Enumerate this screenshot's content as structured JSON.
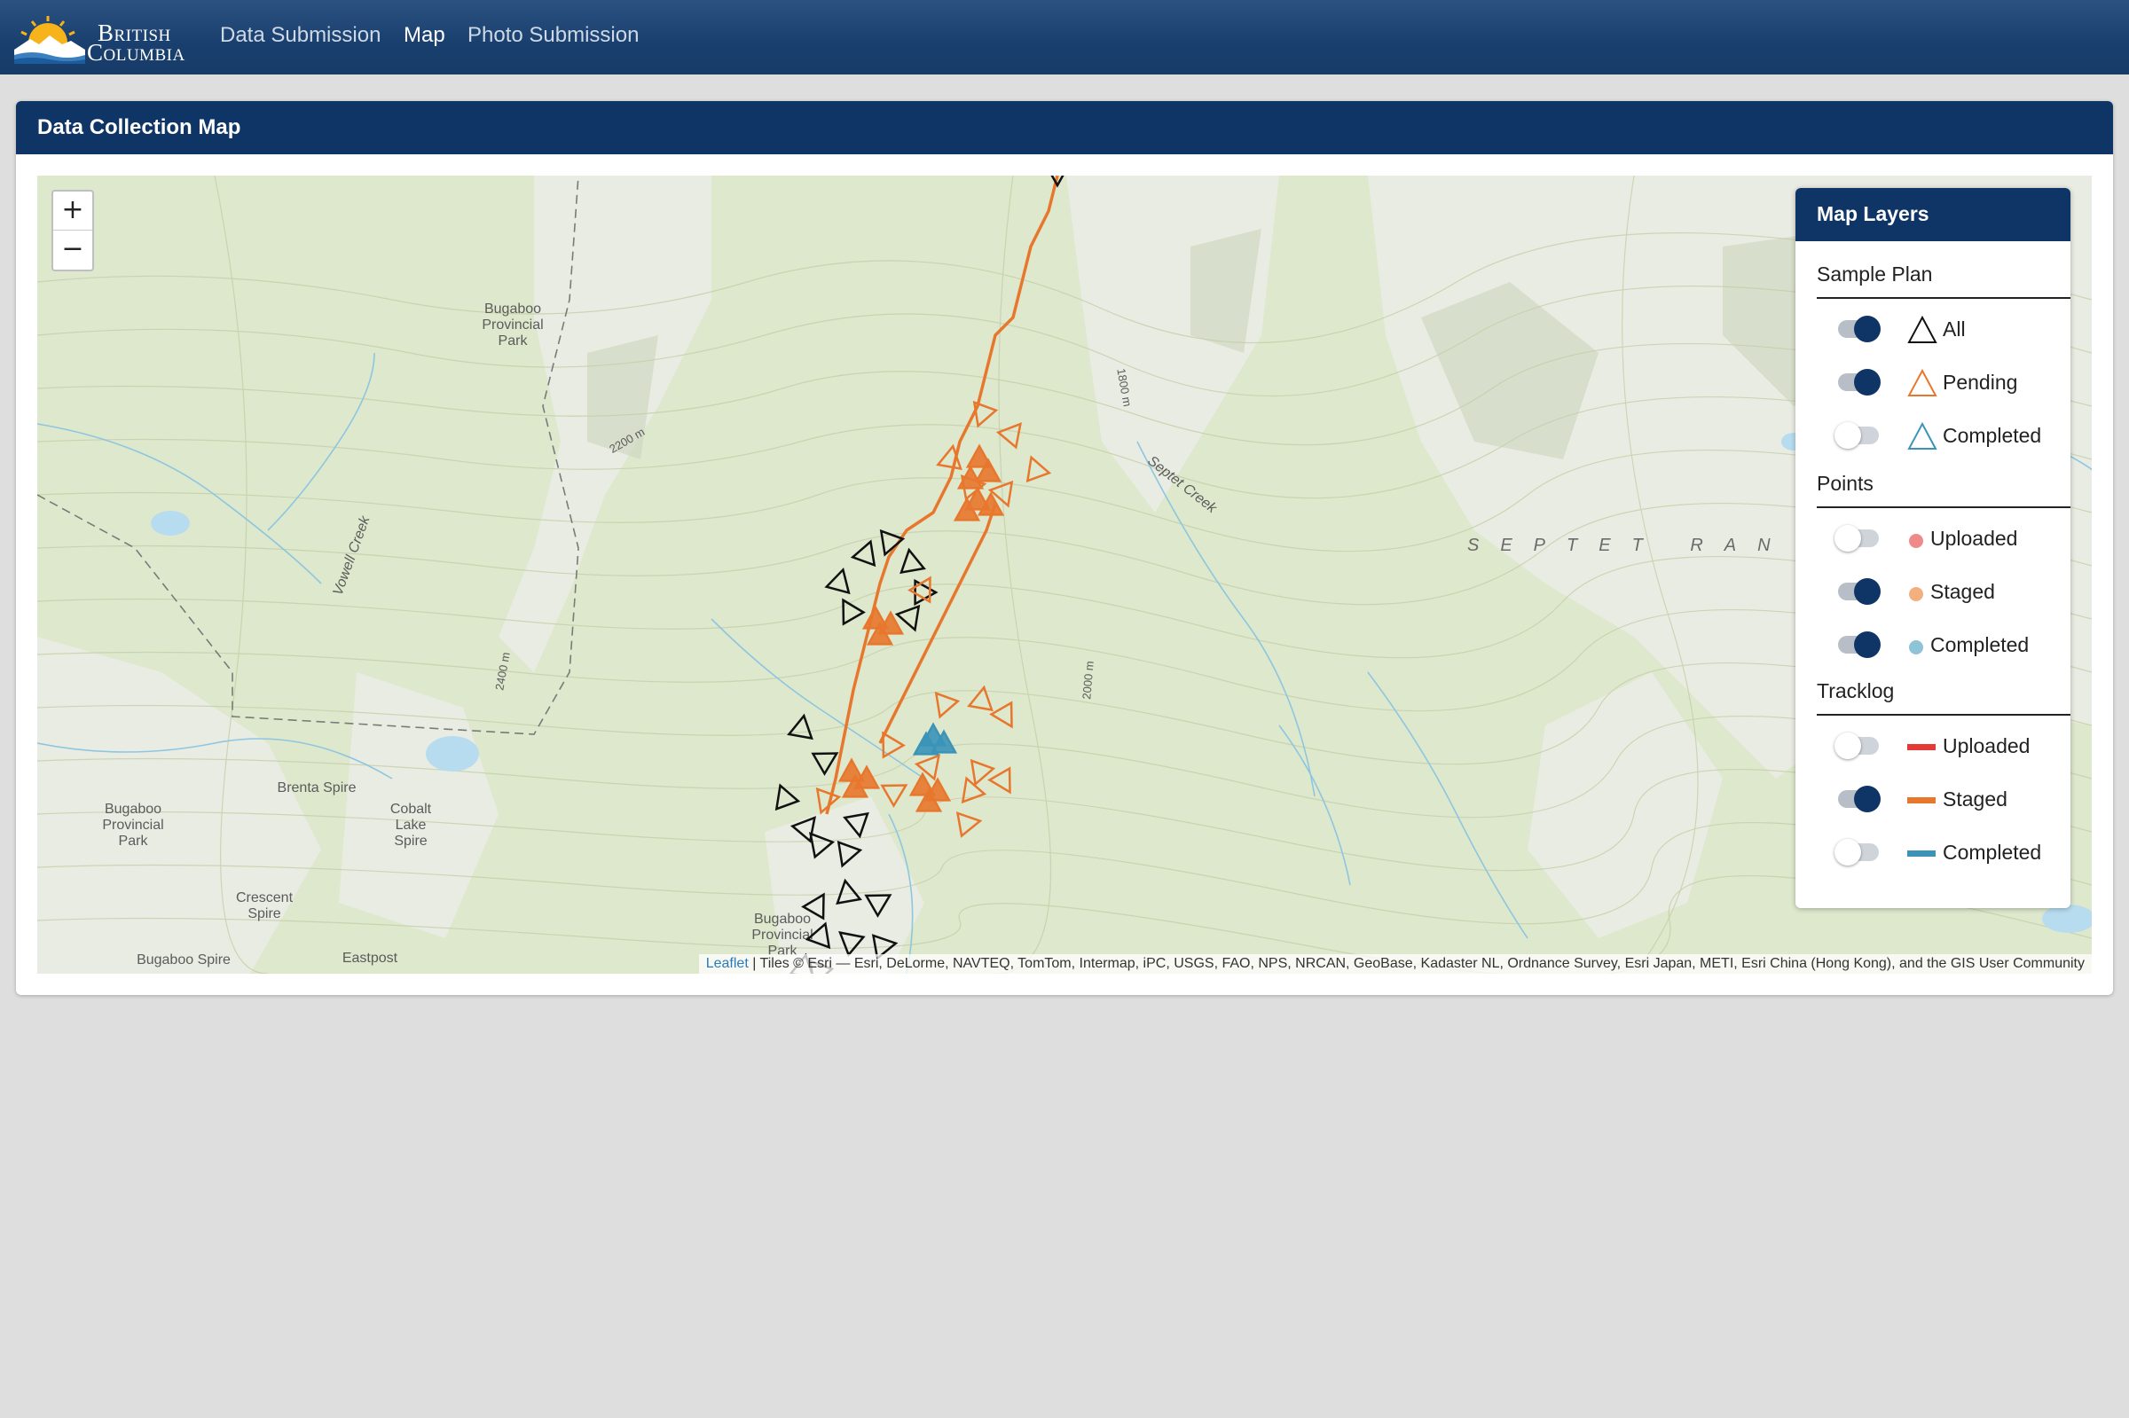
{
  "header": {
    "logo_line1": "British",
    "logo_line2": "Columbia",
    "nav": [
      "Data Submission",
      "Map",
      "Photo Submission"
    ],
    "active_nav": "Map"
  },
  "card": {
    "title": "Data Collection Map"
  },
  "map": {
    "zoom_in": "+",
    "zoom_out": "−",
    "labels": {
      "bugaboo_park_top": "Bugaboo Provincial Park",
      "bugaboo_park_left": "Bugaboo Provincial Park",
      "bugaboo_park_bottom": "Bugaboo Provincial Park",
      "brenta_spire": "Brenta Spire",
      "cobalt_lake_spire": "Cobalt Lake Spire",
      "crescent_spire": "Crescent Spire",
      "bugaboo_spire": "Bugaboo Spire",
      "eastpost": "Eastpost",
      "septet_range": "SEPTET RAN",
      "septet_creek": "Septet Creek",
      "vowell_creek": "Vowell Creek",
      "contour_2200": "2200 m",
      "contour_2400": "2400 m",
      "contour_2000": "2000 m",
      "contour_1800": "1800 m"
    },
    "attribution_link": "Leaflet",
    "attribution_text": " | Tiles © Esri — Esri, DeLorme, NAVTEQ, TomTom, Intermap, iPC, USGS, FAO, NPS, NRCAN, GeoBase, Kadaster NL, Ordnance Survey, Esri Japan, METI, Esri China (Hong Kong), and the GIS User Community"
  },
  "layers_panel": {
    "title": "Map Layers",
    "sections": [
      {
        "title": "Sample Plan",
        "items": [
          {
            "label": "All",
            "on": true,
            "symbol": "triangle",
            "color": "#111111"
          },
          {
            "label": "Pending",
            "on": true,
            "symbol": "triangle",
            "color": "#e8772e"
          },
          {
            "label": "Completed",
            "on": false,
            "symbol": "triangle",
            "color": "#3b94b8"
          }
        ]
      },
      {
        "title": "Points",
        "items": [
          {
            "label": "Uploaded",
            "on": false,
            "symbol": "dot",
            "color": "#f08a8a"
          },
          {
            "label": "Staged",
            "on": true,
            "symbol": "dot",
            "color": "#f2b07e"
          },
          {
            "label": "Completed",
            "on": true,
            "symbol": "dot",
            "color": "#8fc3d6"
          }
        ]
      },
      {
        "title": "Tracklog",
        "items": [
          {
            "label": "Uploaded",
            "on": false,
            "symbol": "line",
            "color": "#e53935"
          },
          {
            "label": "Staged",
            "on": true,
            "symbol": "line",
            "color": "#e8772e"
          },
          {
            "label": "Completed",
            "on": false,
            "symbol": "line",
            "color": "#3b94b8"
          }
        ]
      }
    ]
  },
  "colors": {
    "header_bg": "#193f6e",
    "panel_header": "#0f3566",
    "track_staged": "#e8772e",
    "plan_all": "#111111",
    "point_completed": "#3b94b8"
  }
}
